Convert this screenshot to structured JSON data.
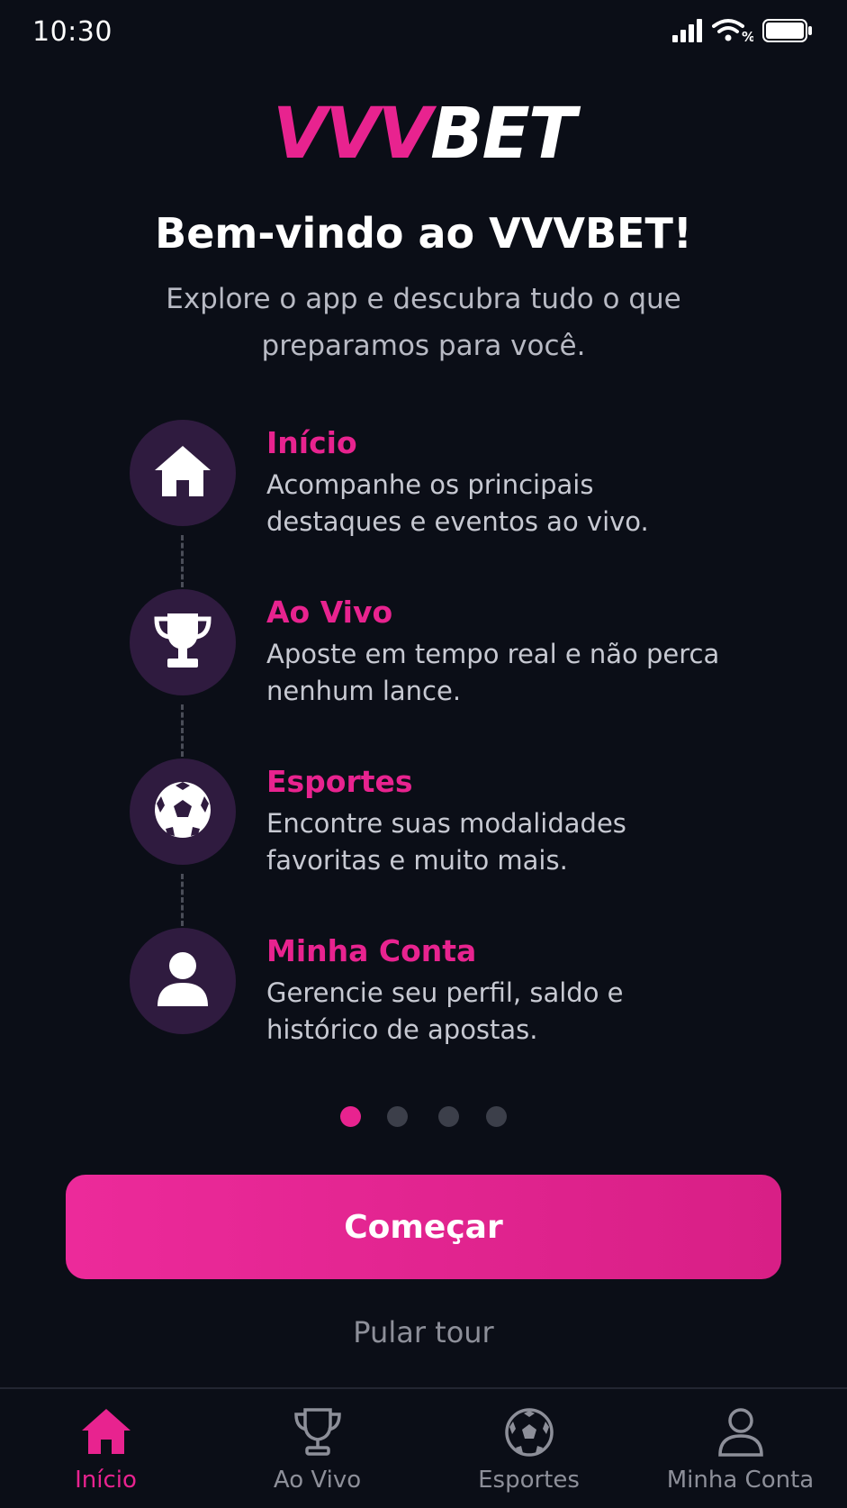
{
  "status_bar": {
    "time": "10:30",
    "icons": [
      "signal-icon",
      "wifi-icon",
      "battery-icon"
    ]
  },
  "logo": {
    "part1": "VVV",
    "part2": "BET"
  },
  "welcome": {
    "title": "Bem-vindo ao VVVBET!",
    "subtitle": "Explore o app e descubra tudo o que preparamos para você."
  },
  "features": [
    {
      "icon": "home-icon",
      "title": "Início",
      "description": "Acompanhe os principais destaques e eventos ao vivo."
    },
    {
      "icon": "trophy-icon",
      "title": "Ao Vivo",
      "description": "Aposte em tempo real e não perca nenhum lance."
    },
    {
      "icon": "soccer-ball-icon",
      "title": "Esportes",
      "description": "Encontre suas modalidades favoritas e muito mais."
    },
    {
      "icon": "user-icon",
      "title": "Minha Conta",
      "description": "Gerencie seu perfil, saldo e histórico de apostas."
    }
  ],
  "pagination": {
    "total": 4,
    "active": 1
  },
  "actions": {
    "start_label": "Começar",
    "skip_label": "Pular tour"
  },
  "bottom_nav": [
    {
      "icon": "home-icon",
      "label": "Início",
      "active": true
    },
    {
      "icon": "trophy-icon",
      "label": "Ao Vivo",
      "active": false
    },
    {
      "icon": "soccer-ball-icon",
      "label": "Esportes",
      "active": false
    },
    {
      "icon": "user-icon",
      "label": "Minha Conta",
      "active": false
    }
  ],
  "colors": {
    "accent": "#e8238f",
    "background": "#0b0e17",
    "icon_circle": "#2f1b3f",
    "muted": "#8d8f99"
  }
}
